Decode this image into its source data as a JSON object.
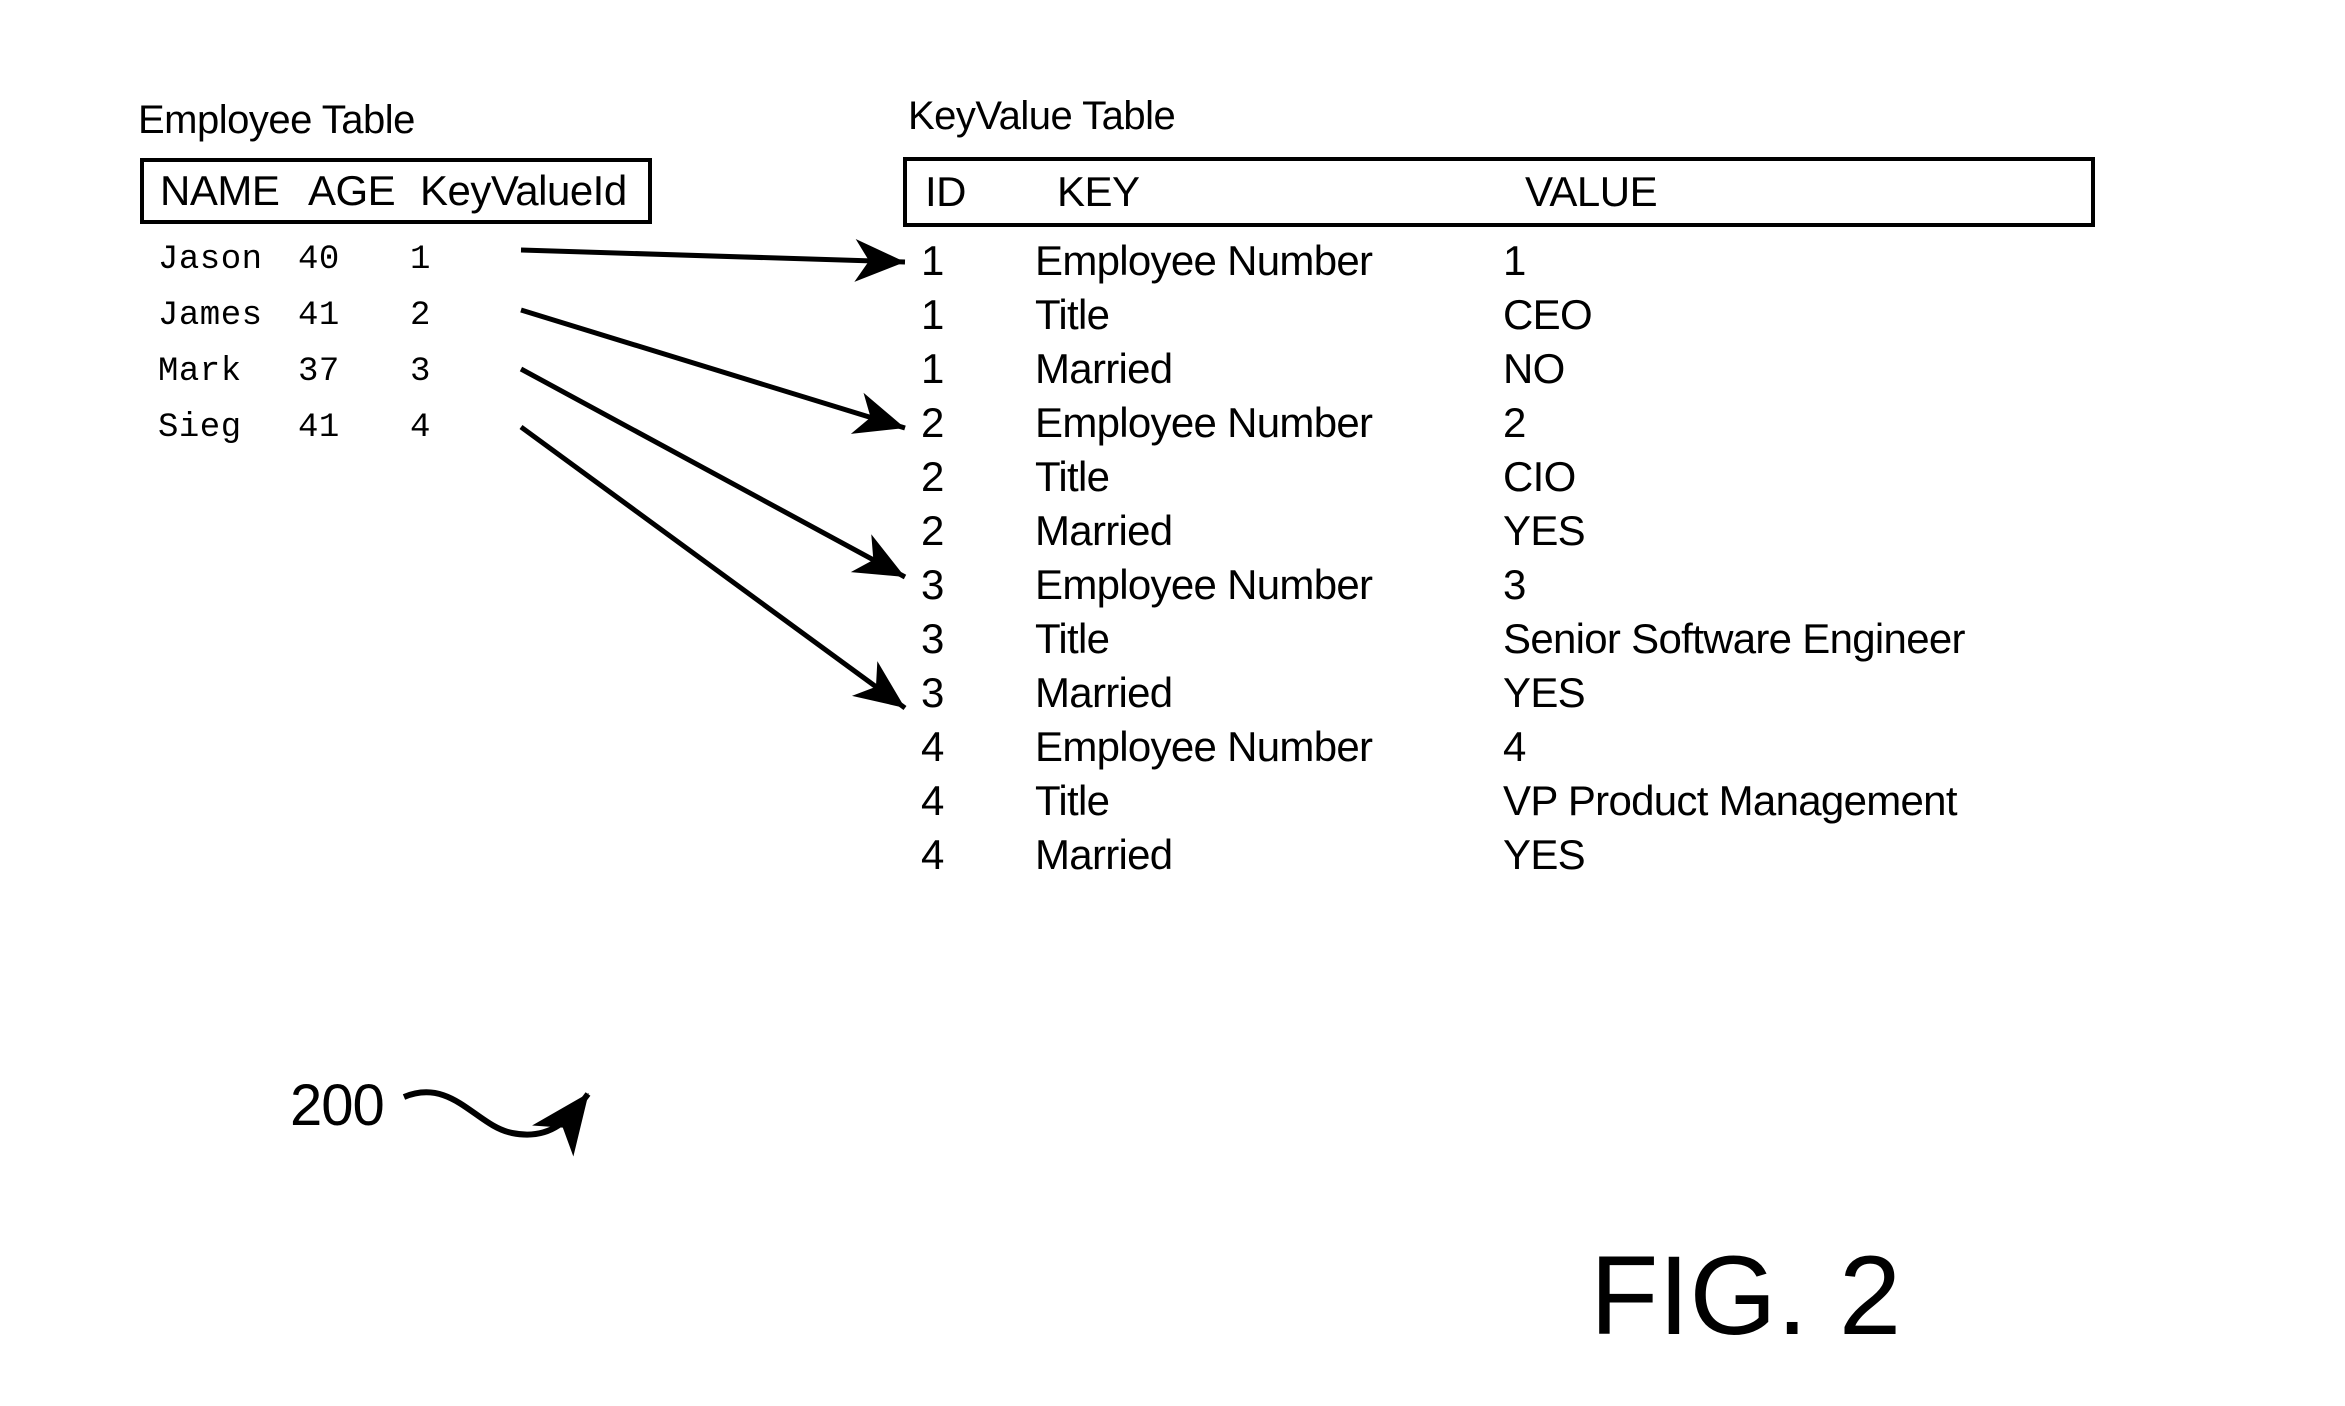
{
  "figure": {
    "label": "FIG. 2",
    "callout_number": "200",
    "callout_arrow": "curved-arrow-icon"
  },
  "employee_table": {
    "caption": "Employee Table",
    "columns": [
      "NAME",
      "AGE",
      "KeyValueId"
    ],
    "rows": [
      {
        "name": "Jason",
        "age": "40",
        "keyvalueid": "1"
      },
      {
        "name": "James",
        "age": "41",
        "keyvalueid": "2"
      },
      {
        "name": "Mark",
        "age": "37",
        "keyvalueid": "3"
      },
      {
        "name": "Sieg",
        "age": "41",
        "keyvalueid": "4"
      }
    ]
  },
  "keyvalue_table": {
    "caption": "KeyValue Table",
    "columns": [
      "ID",
      "KEY",
      "VALUE"
    ],
    "rows": [
      {
        "id": "1",
        "key": "Employee Number",
        "value": "1"
      },
      {
        "id": "1",
        "key": "Title",
        "value": "CEO"
      },
      {
        "id": "1",
        "key": "Married",
        "value": "NO"
      },
      {
        "id": "2",
        "key": "Employee Number",
        "value": "2"
      },
      {
        "id": "2",
        "key": "Title",
        "value": "CIO"
      },
      {
        "id": "2",
        "key": "Married",
        "value": "YES"
      },
      {
        "id": "3",
        "key": "Employee Number",
        "value": "3"
      },
      {
        "id": "3",
        "key": "Title",
        "value": "Senior Software Engineer"
      },
      {
        "id": "3",
        "key": "Married",
        "value": "YES"
      },
      {
        "id": "4",
        "key": "Employee Number",
        "value": "4"
      },
      {
        "id": "4",
        "key": "Title",
        "value": "VP Product Management"
      },
      {
        "id": "4",
        "key": "Married",
        "value": "YES"
      }
    ]
  },
  "relations": [
    {
      "from_keyvalueid": "1",
      "to_group_id": "1",
      "arrow": "link-arrow-icon"
    },
    {
      "from_keyvalueid": "2",
      "to_group_id": "2",
      "arrow": "link-arrow-icon"
    },
    {
      "from_keyvalueid": "3",
      "to_group_id": "3",
      "arrow": "link-arrow-icon"
    },
    {
      "from_keyvalueid": "4",
      "to_group_id": "4",
      "arrow": "link-arrow-icon"
    }
  ],
  "colors": {
    "ink": "#000000",
    "background": "#ffffff"
  }
}
